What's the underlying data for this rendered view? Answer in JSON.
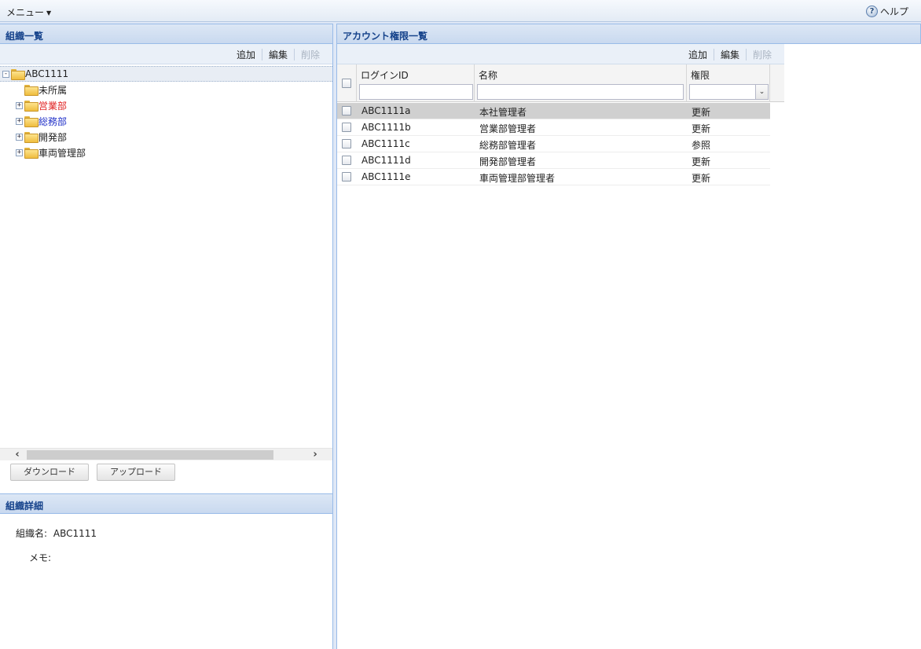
{
  "menubar": {
    "menu_label": "メニュー",
    "help_label": "ヘルプ"
  },
  "org_panel": {
    "title": "組織一覧",
    "toolbar": {
      "add": "追加",
      "edit": "編集",
      "delete": "削除"
    },
    "tree": [
      {
        "label": "ABC1111",
        "expander": "-",
        "color": "#222222",
        "level": 0,
        "selected": true
      },
      {
        "label": "未所属",
        "expander": "",
        "color": "#222222",
        "level": 1
      },
      {
        "label": "営業部",
        "expander": "+",
        "color": "#e02020",
        "level": 1
      },
      {
        "label": "総務部",
        "expander": "+",
        "color": "#2030c8",
        "level": 1
      },
      {
        "label": "開発部",
        "expander": "+",
        "color": "#222222",
        "level": 1
      },
      {
        "label": "車両管理部",
        "expander": "+",
        "color": "#222222",
        "level": 1
      }
    ],
    "download_button": "ダウンロード",
    "upload_button": "アップロード"
  },
  "detail_panel": {
    "title": "組織詳細",
    "org_name_label": "組織名:",
    "org_name_value": "ABC1111",
    "memo_label": "メモ:",
    "memo_value": ""
  },
  "account_panel": {
    "title": "アカウント権限一覧",
    "toolbar": {
      "add": "追加",
      "edit": "編集",
      "delete": "削除"
    },
    "columns": {
      "login_id": "ログインID",
      "name": "名称",
      "permission": "権限"
    },
    "rows": [
      {
        "login_id": "ABC1111a",
        "name": "本社管理者",
        "permission": "更新",
        "selected": true
      },
      {
        "login_id": "ABC1111b",
        "name": "営業部管理者",
        "permission": "更新"
      },
      {
        "login_id": "ABC1111c",
        "name": "総務部管理者",
        "permission": "参照"
      },
      {
        "login_id": "ABC1111d",
        "name": "開発部管理者",
        "permission": "更新"
      },
      {
        "login_id": "ABC1111e",
        "name": "車両管理部管理者",
        "permission": "更新"
      }
    ]
  },
  "icons": {
    "menu_caret": "caret-down-icon",
    "help": "help-icon",
    "tree_folder": "folder-icon",
    "scroll_left": "chevron-left-icon",
    "scroll_right": "chevron-right-icon",
    "combo_arrow": "chevron-down-icon"
  }
}
